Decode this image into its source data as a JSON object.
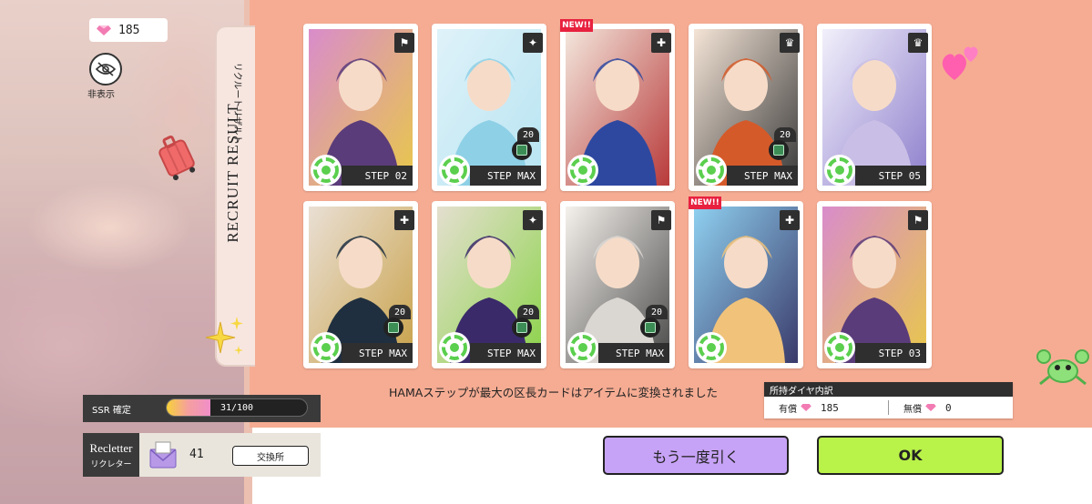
{
  "currency": {
    "gems": "185"
  },
  "hide_label": "非表示",
  "tab": {
    "title": "RECRUIT RESULT",
    "subtitle": "リクルートリザルト"
  },
  "cards": [
    {
      "step": "STEP 02",
      "badge": "flag",
      "count": "",
      "new": false,
      "palette": [
        "#5b3c7a",
        "#d98ccb",
        "#e8c84a"
      ]
    },
    {
      "step": "STEP MAX",
      "badge": "wing",
      "count": "20",
      "new": false,
      "palette": [
        "#8ed0e6",
        "#dff2f9",
        "#b7e4f2"
      ]
    },
    {
      "step": "",
      "badge": "drill",
      "count": "",
      "new": true,
      "palette": [
        "#2e48a0",
        "#f3e6dc",
        "#b83a3a"
      ]
    },
    {
      "step": "STEP MAX",
      "badge": "crown",
      "count": "20",
      "new": false,
      "palette": [
        "#d55a2a",
        "#f4e4d6",
        "#3a3a3a"
      ]
    },
    {
      "step": "STEP 05",
      "badge": "crown",
      "count": "",
      "new": false,
      "palette": [
        "#c9bfe6",
        "#f2f0fb",
        "#8e7fcc"
      ]
    },
    {
      "step": "STEP MAX",
      "badge": "medkit",
      "count": "20",
      "new": false,
      "palette": [
        "#1f2f3f",
        "#e9dfd4",
        "#c9a24a"
      ]
    },
    {
      "step": "STEP MAX",
      "badge": "wing",
      "count": "20",
      "new": false,
      "palette": [
        "#3a2a6a",
        "#e4dfcf",
        "#8cd34a"
      ]
    },
    {
      "step": "STEP MAX",
      "badge": "flag",
      "count": "20",
      "new": false,
      "palette": [
        "#dad6d2",
        "#f5f1ec",
        "#4a4a4a"
      ]
    },
    {
      "step": "",
      "badge": "medkit",
      "count": "",
      "new": true,
      "palette": [
        "#f0c27a",
        "#8fd0f0",
        "#3a3a6a"
      ]
    },
    {
      "step": "STEP 03",
      "badge": "flag",
      "count": "",
      "new": false,
      "palette": [
        "#5b3c7a",
        "#d98ccb",
        "#e8c84a"
      ]
    }
  ],
  "new_label": "NEW!!",
  "notice": "HAMAステップが最大の区長カードはアイテムに変換されました",
  "diamond_breakdown": {
    "title": "所持ダイヤ内訳",
    "paid_label": "有償",
    "paid_value": "185",
    "free_label": "無償",
    "free_value": "0"
  },
  "buttons": {
    "again": "もう一度引く",
    "ok": "OK"
  },
  "ssr": {
    "label": "SSR 確定",
    "progress": "31/100",
    "fraction": 0.31
  },
  "recletter": {
    "en": "Recletter",
    "jp": "リクレター",
    "count": "41",
    "exchange": "交換所"
  },
  "colors": {
    "panel": "#f5ac93",
    "ok": "#b9f249",
    "again": "#c7a3f7"
  }
}
